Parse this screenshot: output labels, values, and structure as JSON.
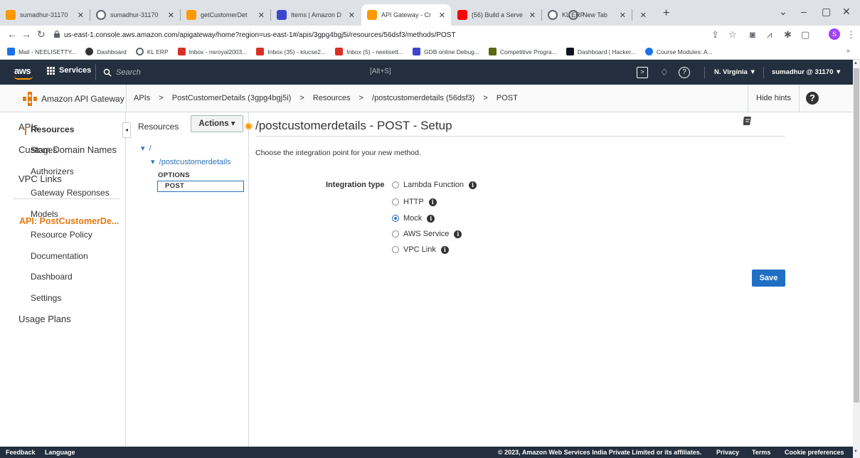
{
  "browser": {
    "tabs": [
      {
        "title": "sumadhur-31170",
        "color": "#ff9900"
      },
      {
        "title": "sumadhur-31170",
        "color": "#5f6368"
      },
      {
        "title": "getCustomerDet",
        "color": "#ff9900"
      },
      {
        "title": "Items | Amazon D",
        "color": "#3b48cc"
      },
      {
        "title": "API Gateway - Cr",
        "color": "#ff9900",
        "active": true
      },
      {
        "title": "(56) Build a Serve",
        "color": "#ff0000"
      },
      {
        "title": "KL ERP",
        "color": "#5f6368"
      },
      {
        "title": "New Tab",
        "color": "#5f6368"
      }
    ],
    "url": "us-east-1.console.aws.amazon.com/apigateway/home?region=us-east-1#/apis/3gpg4bgj5i/resources/56dsf3/methods/POST",
    "profile_initial": "S",
    "bookmarks": [
      {
        "label": "Mail - NEELISETTY...",
        "color": "#1a73e8"
      },
      {
        "label": "Dashboard",
        "color": "#333333"
      },
      {
        "label": "KL ERP",
        "color": "#5f6368"
      },
      {
        "label": "Inbox - nsroyal2003...",
        "color": "#d93025"
      },
      {
        "label": "Inbox (35) - klucse2...",
        "color": "#d93025"
      },
      {
        "label": "Inbox (5) - neelisett...",
        "color": "#d93025"
      },
      {
        "label": "GDB online Debug...",
        "color": "#3b48cc"
      },
      {
        "label": "Competitive Progra...",
        "color": "#5a6a12"
      },
      {
        "label": "Dashboard | Hacker...",
        "color": "#0e141e"
      },
      {
        "label": "Course Modules: A...",
        "color": "#1a73e8"
      }
    ]
  },
  "aws_nav": {
    "logo": "aws",
    "services_label": "Services",
    "search_placeholder": "Search",
    "search_shortcut": "[Alt+S]",
    "region": "N. Virginia ▼",
    "account": "sumadhur @ 31170 ▼"
  },
  "breadcrumb": {
    "service_name": "Amazon API Gateway",
    "items": [
      "APIs",
      ">",
      "PostCustomerDetails (3gpg4bgj5i)",
      ">",
      "Resources",
      ">",
      "/postcustomerdetails (56dsf3)",
      ">",
      "POST"
    ],
    "hide_hints": "Hide hints"
  },
  "sidebar": {
    "top_items": [
      "APIs",
      "Custom Domain Names",
      "VPC Links"
    ],
    "api_prefix": "API:",
    "api_name": "PostCustomerDe...",
    "sub_items": [
      "Resources",
      "Stages",
      "Authorizers",
      "Gateway Responses",
      "Models",
      "Resource Policy",
      "Documentation",
      "Dashboard",
      "Settings"
    ],
    "bottom_item": "Usage Plans"
  },
  "resources": {
    "title": "Resources",
    "actions_label": "Actions ▾",
    "root": "/",
    "child": "/postcustomerdetails",
    "methods": [
      "OPTIONS",
      "POST"
    ]
  },
  "main": {
    "title": "/postcustomerdetails - POST - Setup",
    "instruction": "Choose the integration point for your new method.",
    "integration_label": "Integration type",
    "options": [
      {
        "label": "Lambda Function",
        "checked": false
      },
      {
        "label": "HTTP",
        "checked": false
      },
      {
        "label": "Mock",
        "checked": true
      },
      {
        "label": "AWS Service",
        "checked": false
      },
      {
        "label": "VPC Link",
        "checked": false
      }
    ],
    "save_label": "Save"
  },
  "footer": {
    "feedback": "Feedback",
    "language": "Language",
    "copyright": "© 2023, Amazon Web Services India Private Limited or its affiliates.",
    "privacy": "Privacy",
    "terms": "Terms",
    "cookies": "Cookie preferences"
  }
}
